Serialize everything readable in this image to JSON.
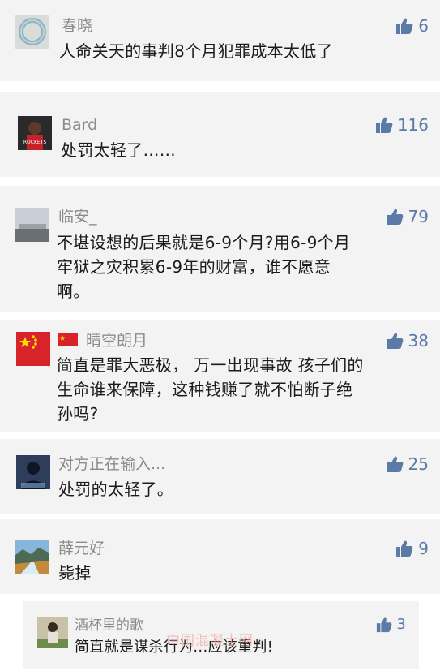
{
  "comments": [
    {
      "name": "春晓",
      "likes": "6",
      "text_lines": [
        "人命关天的事判8个月犯罪成本太低了"
      ]
    },
    {
      "name": "Bard",
      "likes": "116",
      "text_lines": [
        "处罚太轻了……"
      ]
    },
    {
      "name": "临安_",
      "likes": "79",
      "text_lines": [
        "不堪设想的后果就是6-9个月?用6-9个月",
        "牢狱之灾积累6-9年的财富，谁不愿意",
        "啊。"
      ]
    },
    {
      "name": "晴空朗月",
      "likes": "38",
      "text_lines": [
        "简直是罪大恶极， 万一出现事故 孩子们的",
        "生命谁来保障，这种钱赚了就不怕断子绝",
        "孙吗?"
      ]
    },
    {
      "name": "对方正在输入...",
      "likes": "25",
      "text_lines": [
        "处罚的太轻了。"
      ]
    },
    {
      "name": "薛元好",
      "likes": "9",
      "text_lines": [
        "毙掉"
      ]
    },
    {
      "name": "酒杯里的歌",
      "likes": "3",
      "text_lines": [
        "简直就是谋杀行为...应该重判!"
      ]
    }
  ],
  "watermark": "中国混凝土网",
  "icons": {
    "like": "thumbs-up-icon",
    "flag": "china-flag-icon"
  },
  "colors": {
    "like": "#5a7aa8",
    "name": "#8b8b8b",
    "card_bg": "#f3f3f3"
  }
}
